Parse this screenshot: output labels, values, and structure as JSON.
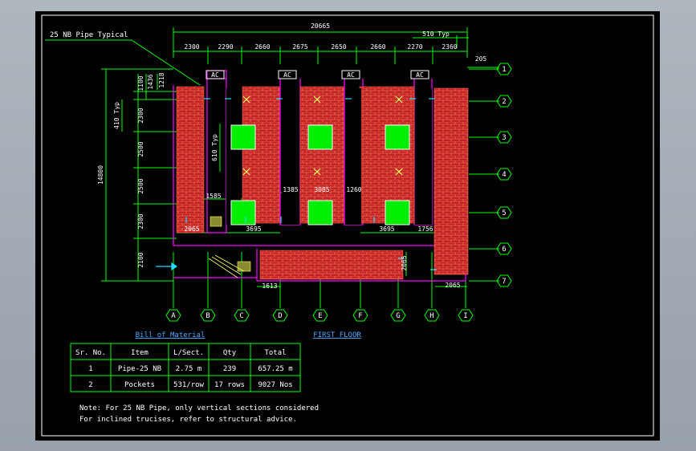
{
  "drawing": {
    "title": "FIRST FLOOR",
    "pipe_callout": "25 NB Pipe Typical",
    "overall_width": "20665",
    "overall_height": "14800",
    "typ_spacing": "510 Typ",
    "right_offset": "205",
    "spacing_410": "410 Typ",
    "spacing_610": "610 Typ",
    "top_bays": [
      "2300",
      "2290",
      "2660",
      "2675",
      "2650",
      "2660",
      "2270",
      "2360"
    ],
    "left_dims": [
      "1100",
      "1436",
      "1218",
      "2300",
      "2500",
      "2500",
      "2300",
      "2100"
    ],
    "inner_dims": {
      "d1585": "1585",
      "d1385": "1385",
      "d3085": "3085",
      "d1260": "1260",
      "d2065a": "2065",
      "d3695a": "3695",
      "d3695b": "3695",
      "d1756": "1756",
      "d2065b": "2065",
      "d1613": "1613",
      "d2065c": "2065"
    },
    "ac_label": "AC",
    "grid_rows": [
      "1",
      "2",
      "3",
      "4",
      "5",
      "6",
      "7"
    ],
    "grid_cols": [
      "A",
      "B",
      "C",
      "D",
      "E",
      "F",
      "G",
      "H",
      "I"
    ]
  },
  "bom": {
    "title": "Bill of Material",
    "headers": [
      "Sr. No.",
      "Item",
      "L/Sect.",
      "Qty",
      "Total"
    ],
    "rows": [
      [
        "1",
        "Pipe-25 NB",
        "2.75  m",
        "239",
        "657.25 m"
      ],
      [
        "2",
        "Pockets",
        "531/row",
        "17 rows",
        "9027 Nos"
      ]
    ]
  },
  "notes": [
    "Note: For 25 NB Pipe, only vertical sections considered",
    "For inclined trucises, refer to structural advice."
  ],
  "colors": {
    "background": "#000000",
    "line": "#00ff00",
    "wall": "#d42b2b",
    "text": "#ffffff",
    "accent": "#ff00ff",
    "title": "#4fa8ff",
    "grid": "#ffff00"
  }
}
